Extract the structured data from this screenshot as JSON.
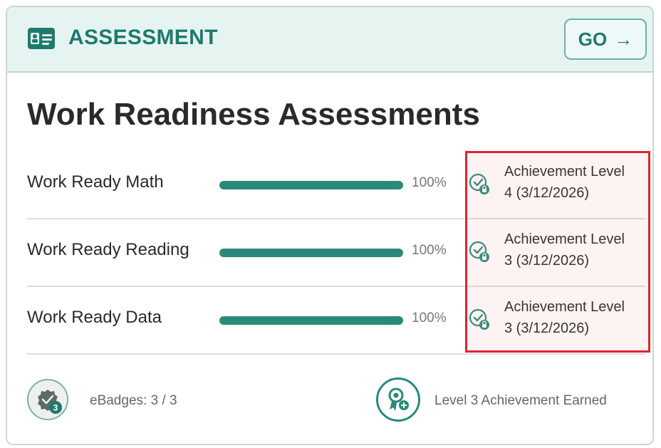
{
  "header": {
    "icon": "id-card-icon",
    "title": "ASSESSMENT",
    "go_label": "GO",
    "go_arrow": "→"
  },
  "page_title": "Work Readiness Assessments",
  "assessments": [
    {
      "name": "Work Ready Math",
      "progress_percent": 100,
      "progress_text": "100%",
      "achievement_line1": "Achievement Level",
      "achievement_line2": "4 (3/12/2026)"
    },
    {
      "name": "Work Ready Reading",
      "progress_percent": 100,
      "progress_text": "100%",
      "achievement_line1": "Achievement Level",
      "achievement_line2": "3 (3/12/2026)"
    },
    {
      "name": "Work Ready Data",
      "progress_percent": 100,
      "progress_text": "100%",
      "achievement_line1": "Achievement Level",
      "achievement_line2": "3 (3/12/2026)"
    }
  ],
  "footer": {
    "badge_count": "3",
    "ebadges_label": "eBadges: 3 / 3",
    "level_label": "Level 3 Achievement Earned"
  },
  "colors": {
    "accent": "#2a8a7a",
    "header_bg": "#e6f4f1",
    "highlight_border": "#e0242e"
  }
}
